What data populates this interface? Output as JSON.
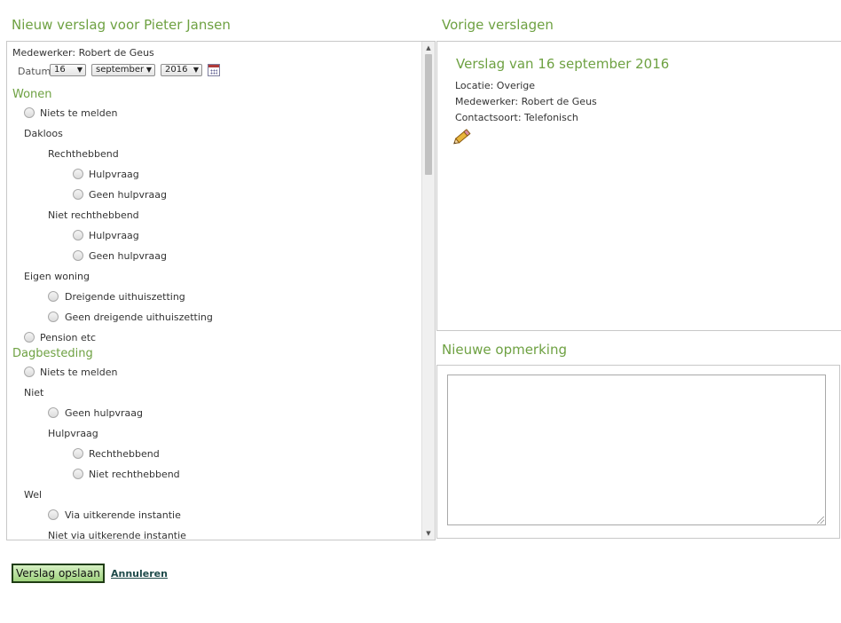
{
  "left": {
    "title": "Nieuw verslag voor Pieter Jansen",
    "medewerker": "Medewerker: Robert de Geus",
    "datum_label": "Datum",
    "day": "16",
    "month": "september",
    "year": "2016",
    "sections": {
      "wonen": "Wonen",
      "dagbesteding": "Dagbesteding"
    },
    "items": {
      "w_niets": "Niets te melden",
      "w_dakloos": "Dakloos",
      "w_rechthebbend": "Rechthebbend",
      "w_r_hulpvraag": "Hulpvraag",
      "w_r_geen": "Geen hulpvraag",
      "w_niet_rechthebbend": "Niet rechthebbend",
      "w_nr_hulpvraag": "Hulpvraag",
      "w_nr_geen": "Geen hulpvraag",
      "w_eigen_woning": "Eigen woning",
      "w_dreigende": "Dreigende uithuiszetting",
      "w_geen_dreigende": "Geen dreigende uithuiszetting",
      "w_pension": "Pension etc",
      "d_niets": "Niets te melden",
      "d_niet": "Niet",
      "d_geen_hulpvraag": "Geen hulpvraag",
      "d_hulpvraag": "Hulpvraag",
      "d_rechthebbend": "Rechthebbend",
      "d_niet_rechthebbend": "Niet rechthebbend",
      "d_wel": "Wel",
      "d_via": "Via uitkerende instantie",
      "d_niet_via": "Niet via uitkerende instantie"
    }
  },
  "right": {
    "title": "Vorige verslagen",
    "report_title": "Verslag van 16 september 2016",
    "locatie": "Locatie: Overige",
    "medewerker": "Medewerker: Robert de Geus",
    "contactsoort": "Contactsoort: Telefonisch",
    "comment_title": "Nieuwe opmerking"
  },
  "actions": {
    "save": "Verslag opslaan",
    "cancel": "Annuleren"
  }
}
